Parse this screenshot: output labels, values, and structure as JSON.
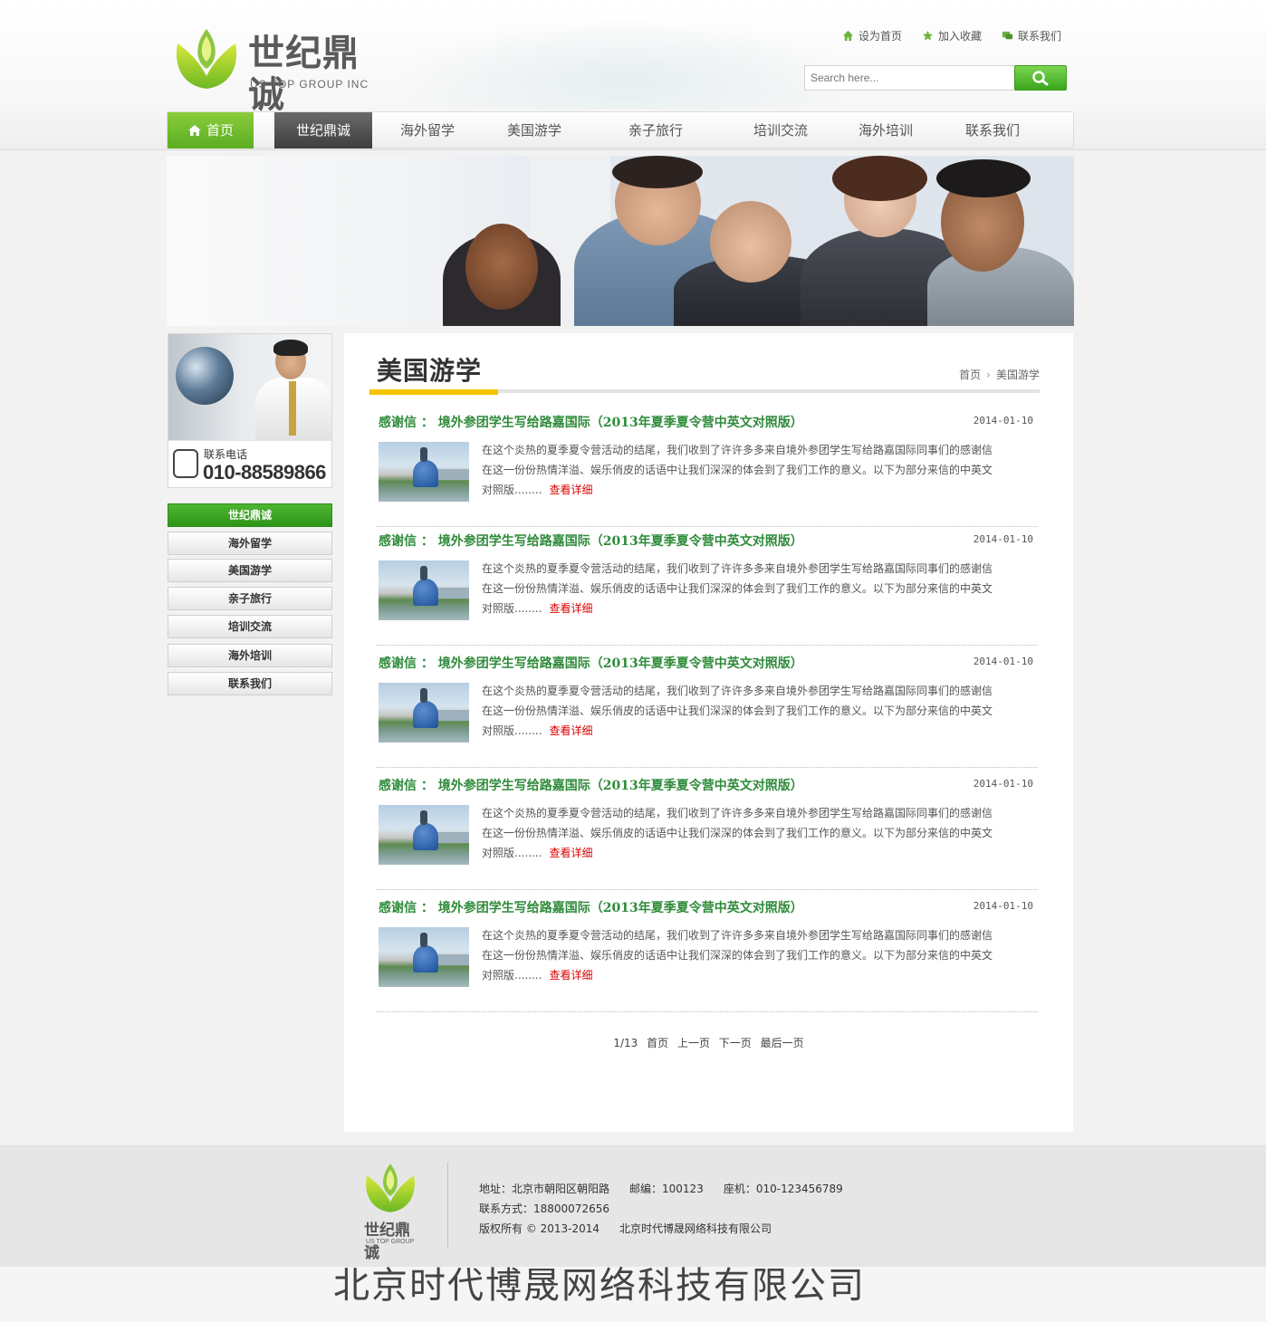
{
  "header": {
    "logo_text": "世纪鼎诚",
    "logo_sub": "US TOP GROUP INC",
    "toplinks": [
      "设为首页",
      "加入收藏",
      "联系我们"
    ],
    "search_placeholder": "Search here..."
  },
  "nav": {
    "items": [
      "首页",
      "世纪鼎诚",
      "海外留学",
      "美国游学",
      "亲子旅行",
      "培训交流",
      "海外培训",
      "联系我们"
    ]
  },
  "sidebar": {
    "contact_label": "联系电话",
    "contact_phone": "010-88589866",
    "menu": [
      "世纪鼎诚",
      "海外留学",
      "美国游学",
      "亲子旅行",
      "培训交流",
      "海外培训",
      "联系我们"
    ]
  },
  "main": {
    "title": "美国游学",
    "breadcrumb": [
      "首页",
      "美国游学"
    ],
    "articles": [
      {
        "title": "感谢信 ： 境外参团学生写给路嘉国际（2013年夏季夏令营中英文对照版）",
        "date": "2014-01-10",
        "line1": "在这个炎热的夏季夏令营活动的结尾，我们收到了许许多多来自境外参团学生写给路嘉国际同事们的感谢信",
        "line2": "在这一份份热情洋溢、娱乐俏皮的话语中让我们深深的体会到了我们工作的意义。以下为部分来信的中英文",
        "line3": "对照版........",
        "more": "查看详细"
      },
      {
        "title": "感谢信 ： 境外参团学生写给路嘉国际（2013年夏季夏令营中英文对照版）",
        "date": "2014-01-10",
        "line1": "在这个炎热的夏季夏令营活动的结尾，我们收到了许许多多来自境外参团学生写给路嘉国际同事们的感谢信",
        "line2": "在这一份份热情洋溢、娱乐俏皮的话语中让我们深深的体会到了我们工作的意义。以下为部分来信的中英文",
        "line3": "对照版........",
        "more": "查看详细"
      },
      {
        "title": "感谢信 ： 境外参团学生写给路嘉国际（2013年夏季夏令营中英文对照版）",
        "date": "2014-01-10",
        "line1": "在这个炎热的夏季夏令营活动的结尾，我们收到了许许多多来自境外参团学生写给路嘉国际同事们的感谢信",
        "line2": "在这一份份热情洋溢、娱乐俏皮的话语中让我们深深的体会到了我们工作的意义。以下为部分来信的中英文",
        "line3": "对照版........",
        "more": "查看详细"
      },
      {
        "title": "感谢信 ： 境外参团学生写给路嘉国际（2013年夏季夏令营中英文对照版）",
        "date": "2014-01-10",
        "line1": "在这个炎热的夏季夏令营活动的结尾，我们收到了许许多多来自境外参团学生写给路嘉国际同事们的感谢信",
        "line2": "在这一份份热情洋溢、娱乐俏皮的话语中让我们深深的体会到了我们工作的意义。以下为部分来信的中英文",
        "line3": "对照版........",
        "more": "查看详细"
      },
      {
        "title": "感谢信 ： 境外参团学生写给路嘉国际（2013年夏季夏令营中英文对照版）",
        "date": "2014-01-10",
        "line1": "在这个炎热的夏季夏令营活动的结尾，我们收到了许许多多来自境外参团学生写给路嘉国际同事们的感谢信",
        "line2": "在这一份份热情洋溢、娱乐俏皮的话语中让我们深深的体会到了我们工作的意义。以下为部分来信的中英文",
        "line3": "对照版........",
        "more": "查看详细"
      }
    ],
    "pager": {
      "page_info": "1/13",
      "first": "首页",
      "prev": "上一页",
      "next": "下一页",
      "last": "最后一页"
    }
  },
  "footer": {
    "logo_text": "世纪鼎诚",
    "logo_sub": "US TOP GROUP INC",
    "address": "地址：北京市朝阳区朝阳路",
    "zipcode": "邮编：100123",
    "landline": "座机：010-123456789",
    "contact": "联系方式：18800072656",
    "copyright": "版权所有 © 2013-2014",
    "company": "北京时代博晟网络科技有限公司"
  },
  "bottom_brand": "北京时代博晟网络科技有限公司",
  "colors": {
    "brand_green": "#5aad23",
    "link_green": "#2e8b3a",
    "accent_yellow": "#f5c400",
    "more_red": "#dd0000"
  }
}
